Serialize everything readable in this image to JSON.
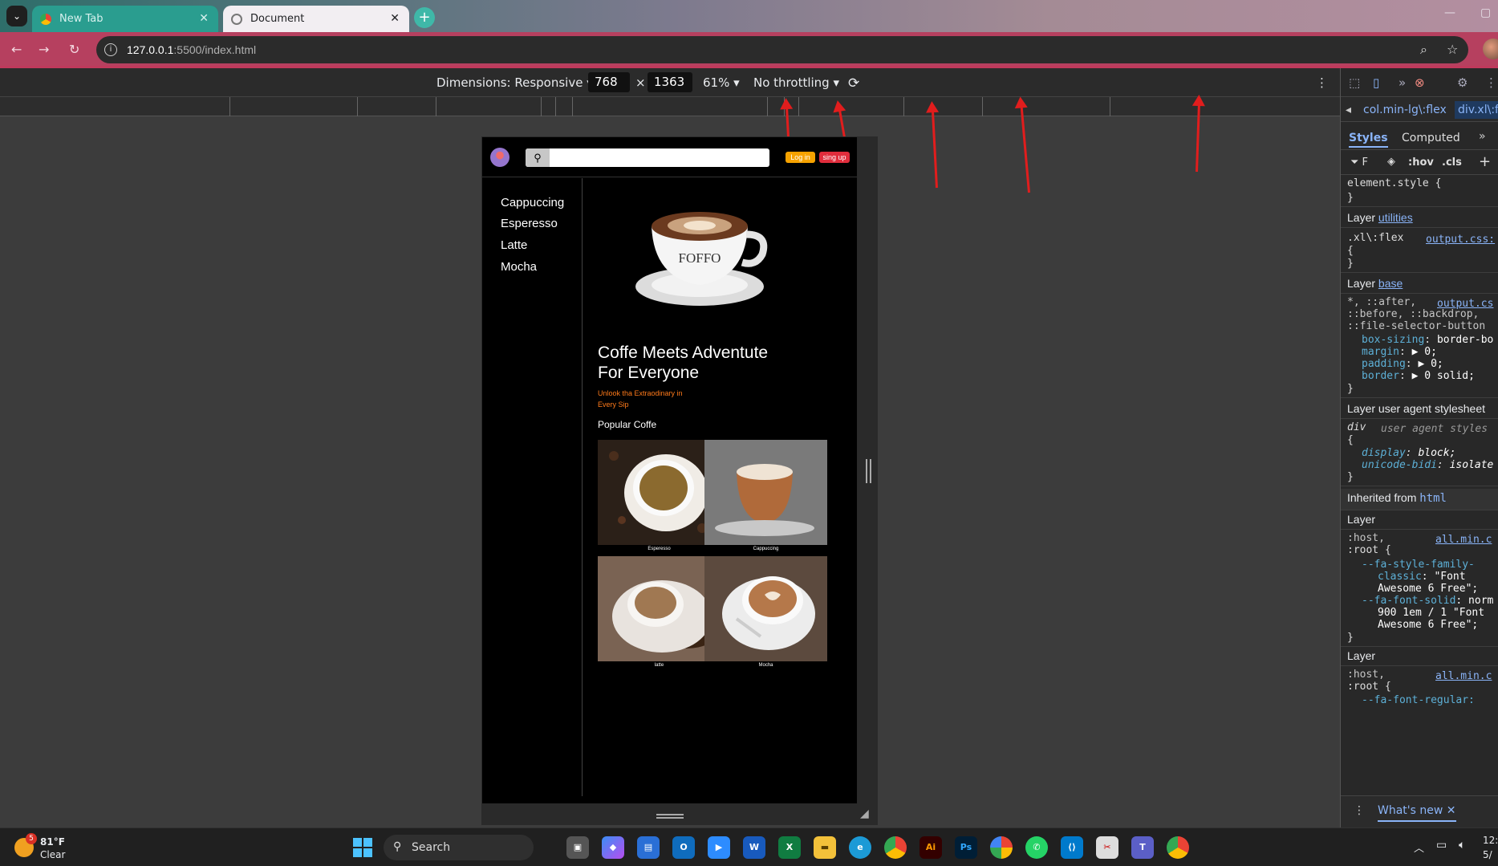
{
  "browser": {
    "tabs": [
      {
        "title": "New Tab",
        "close": "✕"
      },
      {
        "title": "Document",
        "close": "✕"
      }
    ],
    "new_tab": "+",
    "url_host": "127.0.0.1",
    "url_path": ":5500/index.html",
    "window_controls": [
      "—",
      "▢"
    ]
  },
  "device_toolbar": {
    "dimensions_label": "Dimensions: Responsive",
    "width": "768",
    "times": "×",
    "height": "1363",
    "zoom": "61%",
    "throttling": "No throttling"
  },
  "site": {
    "search_placeholder": "",
    "login_label": "Log in",
    "signup_label": "sing up",
    "sidebar": [
      "Cappuccing",
      "Esperesso",
      "Latte",
      "Mocha"
    ],
    "hero_title": "Coffe Meets Adventute For Everyone",
    "hero_subtitle": "Unlook tha Extraodinary in Every Sip",
    "popular_heading": "Popular Coffe",
    "cards": [
      {
        "caption": "Esperesso"
      },
      {
        "caption": "Cappuccing"
      },
      {
        "caption": "latte"
      },
      {
        "caption": "Mocha"
      }
    ],
    "cup_brand": "FOFFO"
  },
  "devtools": {
    "breadcrumbs": [
      "col.min-lg\\:flex",
      "div.xl\\:fl"
    ],
    "tabs": [
      "Styles",
      "Computed"
    ],
    "filter_tools": [
      ":hov",
      ".cls"
    ],
    "styles": {
      "element_style": "element.style {",
      "close_brace": "}",
      "layer_utilities": "Layer",
      "utilities_link": "utilities",
      "xl_selector": ".xl\\:flex",
      "output_link": "output.css:",
      "open_brace": "{",
      "layer_base": "Layer",
      "base_link": "base",
      "base_sel1": "*, ::after,",
      "output_link2": "output.cs",
      "base_sel2": "::before, ::backdrop,",
      "base_sel3": "::file-selector-button",
      "p_boxsizing": "box-sizing",
      "v_boxsizing": "border-bo",
      "p_margin": "margin",
      "v_margin": "▶ 0;",
      "p_padding": "padding",
      "v_padding": "▶ 0;",
      "p_border": "border",
      "v_border": "▶ 0 solid;",
      "layer_ua": "Layer user agent stylesheet",
      "div_sel": "div",
      "ua_note": "user agent styles",
      "p_display": "display",
      "v_display": "block;",
      "p_unicode": "unicode-bidi",
      "v_unicode": "isolate",
      "inherited": "Inherited from",
      "inherited_html": "html",
      "layer3": "Layer",
      "host_sel": ":host,",
      "allmin": "all.min.c",
      "root_sel": ":root {",
      "fa_family": "--fa-style-family-",
      "fa_family2": "classic",
      "fa_family_val": ": \"Font",
      "fa_family_val2": "Awesome 6 Free\";",
      "fa_solid": "--fa-font-solid",
      "fa_solid_val": ": norm",
      "fa_solid_val2": "900 1em / 1 \"Font",
      "fa_solid_val3": "Awesome 6 Free\";",
      "layer4": "Layer",
      "host_sel2": ":host,",
      "allmin2": "all.min.c",
      "root_sel2": ":root {",
      "fa_regular": "--fa-font-regular:"
    },
    "whats_new": "What's new"
  },
  "taskbar": {
    "weather_temp": "81°F",
    "weather_cond": "Clear",
    "weather_badge": "5",
    "search_label": "Search",
    "clock": "12:",
    "date": "5/"
  },
  "colors": {
    "tab_bar_accent": "#2a9d8f",
    "address_bar": "#b6405f",
    "login": "#f6a200",
    "signup": "#e02d3c",
    "subtitle": "#ff7a1a"
  }
}
